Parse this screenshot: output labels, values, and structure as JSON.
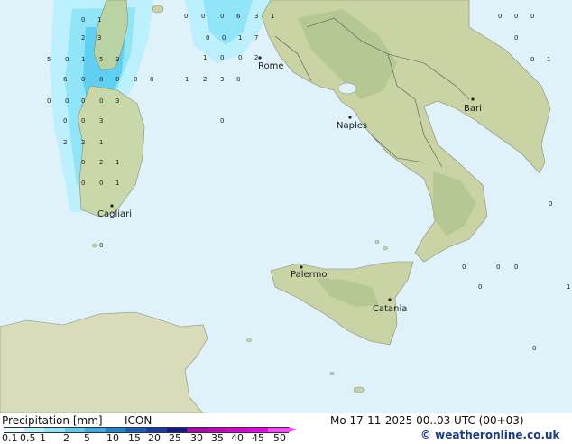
{
  "map": {
    "cities": [
      {
        "name": "Rome"
      },
      {
        "name": "Naples"
      },
      {
        "name": "Bari"
      },
      {
        "name": "Cagliari"
      },
      {
        "name": "Palermo"
      },
      {
        "name": "Catania"
      }
    ],
    "values": [
      "0",
      "0",
      "0",
      "6",
      "3",
      "1",
      "2",
      "3",
      "0",
      "0",
      "1",
      "7",
      "5",
      "0",
      "1",
      "5",
      "3",
      "6",
      "0",
      "0",
      "0",
      "0",
      "0",
      "1",
      "2",
      "3",
      "0",
      "0",
      "0",
      "0",
      "0",
      "3",
      "0",
      "0",
      "3",
      "2",
      "2",
      "1",
      "0",
      "2",
      "1",
      "0",
      "0",
      "1",
      "0",
      "0",
      "0",
      "0",
      "0",
      "0",
      "1",
      "0",
      "0",
      "0",
      "0",
      "0",
      "0",
      "1",
      "0",
      "1",
      "0",
      "0",
      "2",
      "1",
      "0"
    ]
  },
  "footer": {
    "title": "Precipitation [mm]",
    "model": "ICON",
    "datetime": "Mo 17-11-2025 00..03 UTC (00+03)",
    "credit": "© weatheronline.co.uk"
  },
  "legend": {
    "ticks": [
      "0.1",
      "0.5",
      "1",
      "2",
      "5",
      "10",
      "15",
      "20",
      "25",
      "30",
      "35",
      "40",
      "45",
      "50"
    ],
    "colors": [
      "#e6fbff",
      "#b6f0fb",
      "#88e3f7",
      "#5acdf0",
      "#33aee8",
      "#1a86d6",
      "#1a5fc4",
      "#1a3aa8",
      "#101a8a",
      "#b200b2",
      "#c800c8",
      "#dd00dd",
      "#f000f0",
      "#ff40ff"
    ]
  }
}
